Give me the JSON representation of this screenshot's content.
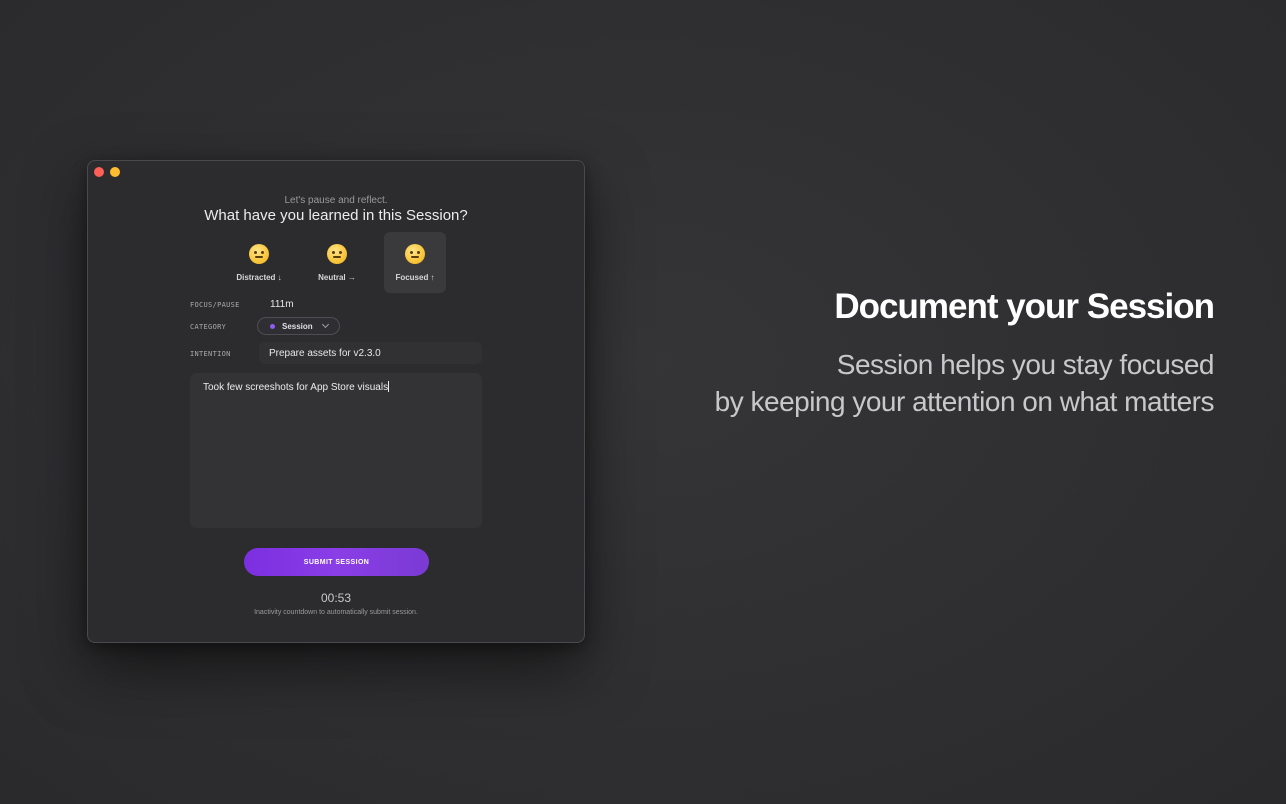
{
  "window": {
    "traffic_lights": [
      "close",
      "minimize"
    ],
    "subtitle": "Let's pause and reflect.",
    "question": "What have you learned in this Session?",
    "moods": [
      {
        "label": "Distracted ↓",
        "icon": "pensive-face-emoji",
        "selected": false
      },
      {
        "label": "Neutral →",
        "icon": "slight-smile-emoji",
        "selected": false
      },
      {
        "label": "Focused ↑",
        "icon": "star-struck-emoji",
        "selected": true
      }
    ],
    "focus_pause": {
      "label": "FOCUS/PAUSE",
      "value": "111m"
    },
    "category": {
      "label": "CATEGORY",
      "value": "Session",
      "dot_color": "#8e5cf0"
    },
    "intention": {
      "label": "INTENTION",
      "value": "Prepare assets for v2.3.0"
    },
    "notes": "Took few screeshots for App Store visuals",
    "submit_label": "SUBMIT SESSION",
    "submit_color": "#7b2fe0",
    "countdown": "00:53",
    "countdown_note": "Inactivity countdown to automatically submit session."
  },
  "hero": {
    "title": "Document your Session",
    "tagline_line1": "Session helps you stay focused",
    "tagline_line2": "by keeping your attention on what matters"
  }
}
